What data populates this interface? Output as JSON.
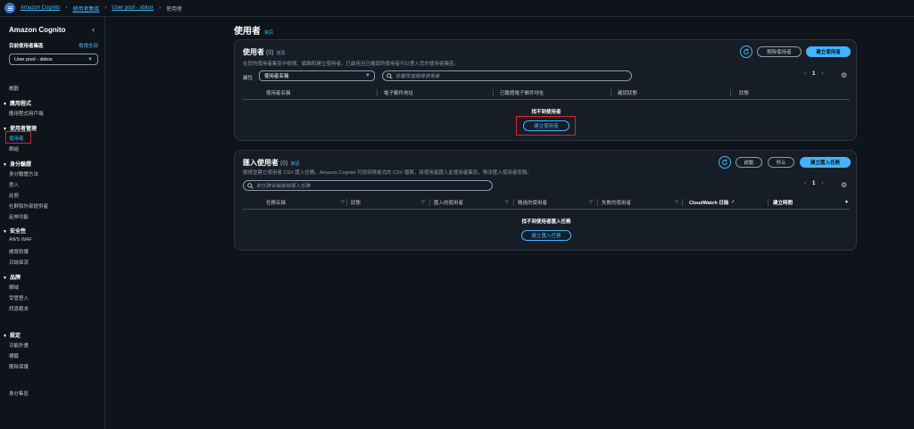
{
  "breadcrumb": [
    "Amazon Cognito",
    "使用者集區",
    "User pool - xbkox",
    "使用者"
  ],
  "sidebar": {
    "title": "Amazon Cognito",
    "pool_label": "目前使用者集區",
    "view_all": "檢視全部",
    "pool_value": "User pool - xbkox",
    "overview": "概觀",
    "sections": [
      {
        "title": "應用程式",
        "items": [
          "應用程式用戶端"
        ]
      },
      {
        "title": "使用者管理",
        "items": [
          "使用者",
          "群組"
        ]
      },
      {
        "title": "身分驗證",
        "items": [
          "身分驗證方法",
          "登入",
          "註冊",
          "社群和外部提供者",
          "延伸功能"
        ]
      },
      {
        "title": "安全性",
        "items": [
          "AWS WAF",
          "威脅防護",
          "日誌串流"
        ]
      },
      {
        "title": "品牌",
        "items": [
          "網域",
          "受管登入",
          "訊息範本"
        ]
      },
      {
        "title": "設定",
        "items": [
          "功能計畫",
          "標籤",
          "刪除保護"
        ]
      }
    ],
    "identity_pools": "身分集區"
  },
  "page_title": "使用者",
  "info": "資訊",
  "users_panel": {
    "title": "使用者",
    "count": "(0)",
    "description": "在您的使用者集區中檢視、編輯和建立使用者。已啟用且已確認的使用者可以登入您的使用者集區。",
    "delete_button": "刪除使用者",
    "create_button": "建立使用者",
    "property_label": "屬性",
    "property_value": "使用者名稱",
    "search_placeholder": "依屬性值搜尋使用者",
    "page": "1",
    "columns": [
      "使用者名稱",
      "電子郵件地址",
      "已驗證電子郵件地址",
      "確認狀態",
      "狀態"
    ],
    "empty_title": "找不到使用者",
    "empty_button": "建立使用者"
  },
  "import_panel": {
    "title": "匯入使用者",
    "count": "(0)",
    "description": "檢視並建立使用者 CSV 匯入任務。Amazon Cognito 可從特殊格式的 CSV 檔案，將使用者匯入此使用者集區，無法匯入使用者密碼。",
    "start_button": "啟動",
    "stop_button": "停止",
    "create_button": "建立匯入任務",
    "search_placeholder": "依任務名稱搜尋匯入任務",
    "page": "1",
    "columns": [
      "任務名稱",
      "狀態",
      "匯入的使用者",
      "略過的使用者",
      "失敗的使用者",
      "CloudWatch 日誌",
      "建立時間"
    ],
    "empty_title": "找不到使用者匯入任務",
    "empty_button": "建立匯入任務"
  },
  "colors": {
    "accent": "#42b4ff",
    "highlight": "#e0202a",
    "background": "#0f141a",
    "panel": "#161d26"
  }
}
